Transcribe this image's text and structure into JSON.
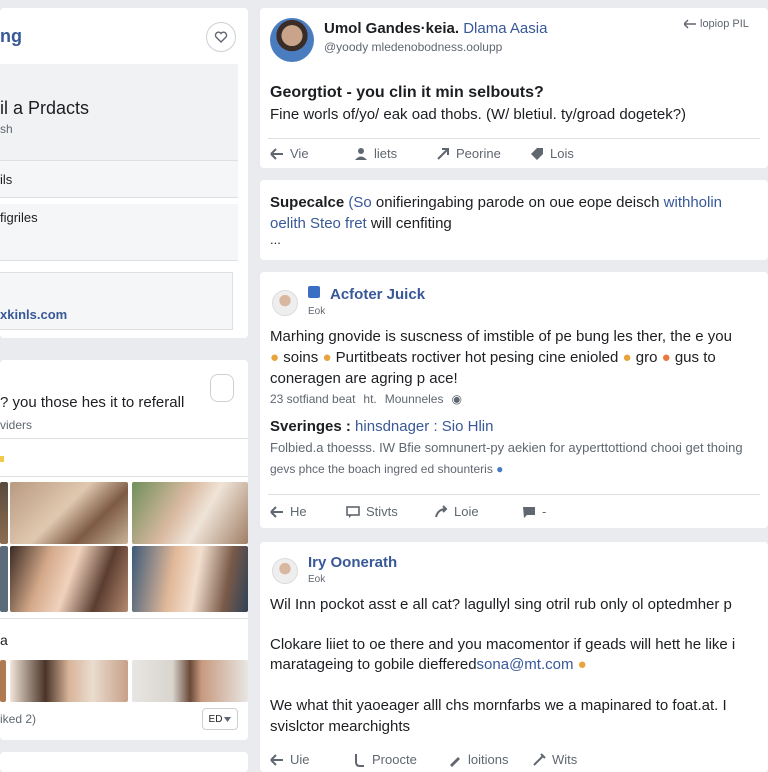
{
  "left_panel": {
    "title": "ng",
    "section_title": "il a Prdacts",
    "section_sub": "sh",
    "item_1": "ils",
    "item_2": "figriles",
    "link": "xkinls.com"
  },
  "left_card2": {
    "question": "? you those hes it to referall",
    "sub": "viders",
    "footer_label": "a",
    "liked": "iked 2)",
    "counter": "ED"
  },
  "post1": {
    "author": "Umol Gandes·keia.",
    "author_link": "Dlama Aasia",
    "handle": "@yoody mledenobodness.oolupp",
    "corner": "lopiop PIL",
    "title": "Georgtiot - you clin it min selbouts?",
    "body": "Fine worls of/yo/ eak oad thobs. (W/ bletiul. ty/groad dogetek?)",
    "actions": [
      "Vie",
      "liets",
      "Peorine",
      "Lois"
    ]
  },
  "post2": {
    "line1_a": "Supecalce",
    "line1_b": "(So",
    "line1_c": "onifieringabing parode",
    "line1_d": "on oue eope deisch",
    "line1_link": "withholin",
    "line2_link": "oelith Steo fret",
    "line2_rest": "will cenfiting",
    "line3": "..."
  },
  "post3": {
    "author": "Acfoter Juick",
    "sub": "Eok",
    "body_1": "Marhing gnovide is suscness of imstible of pe bung les ther, the e you",
    "body_2a": "soins",
    "body_2b": "Purtitbeats roctiver hot pesing cine enioled",
    "body_2c": "gro",
    "body_2d": "gus to",
    "body_3": "coneragen are agring p ace!",
    "meta_1": "23 sotfiand beat",
    "meta_2": "ht.",
    "meta_3": "Mounneles",
    "shared_title": "Sveringes :",
    "shared_link": "hinsdnager : Sio Hlin",
    "shared_body": "Folbied.a thoesss. IW Bfie somnunert-py aekien for ayperttottiond chooi get thoing",
    "shared_note": "gevs phce the boach ingred ed shounteris",
    "actions": [
      "He",
      "Stivts",
      "Loie",
      "-"
    ]
  },
  "post4": {
    "author": "Iry Oonerath",
    "sub": "Eok",
    "body_1": "Wil Inn pockot asst e all cat? lagullyl sing otril rub only ol optedmher p",
    "body_2": "Clokare liiet to oe there and you macomentor if geads will hett he like i",
    "body_3a": "maratageing to gobile dieffered",
    "body_3_link": "sona@mt.com",
    "body_4": "We what thit yaoeager alll chs mornfarbs we a mapinared to foat.at. I",
    "body_5": "svislctor mearchights",
    "actions": [
      "Uie",
      "Proocte",
      "loitions",
      "Wits"
    ]
  },
  "colors": {
    "accent": "#385898",
    "bg": "#e9ebee",
    "card": "#ffffff",
    "muted": "#606770"
  }
}
